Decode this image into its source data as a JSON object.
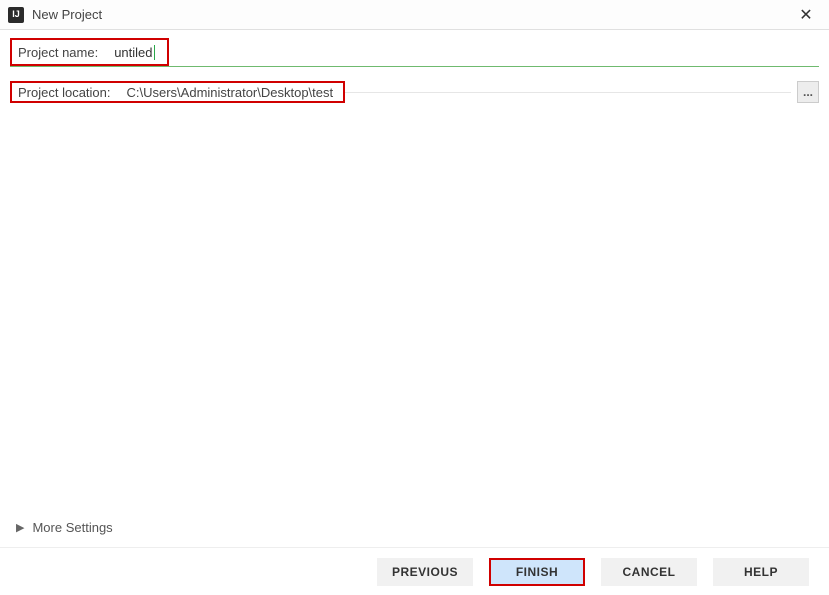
{
  "window": {
    "icon_letter": "IJ",
    "title": "New Project"
  },
  "fields": {
    "name_label": "Project name:",
    "name_value": "untiled",
    "location_label": "Project location:",
    "location_value": "C:\\Users\\Administrator\\Desktop\\test",
    "browse_label": "..."
  },
  "more_settings_label": "More Settings",
  "buttons": {
    "previous": "PREVIOUS",
    "finish": "FINISH",
    "cancel": "CANCEL",
    "help": "HELP"
  }
}
